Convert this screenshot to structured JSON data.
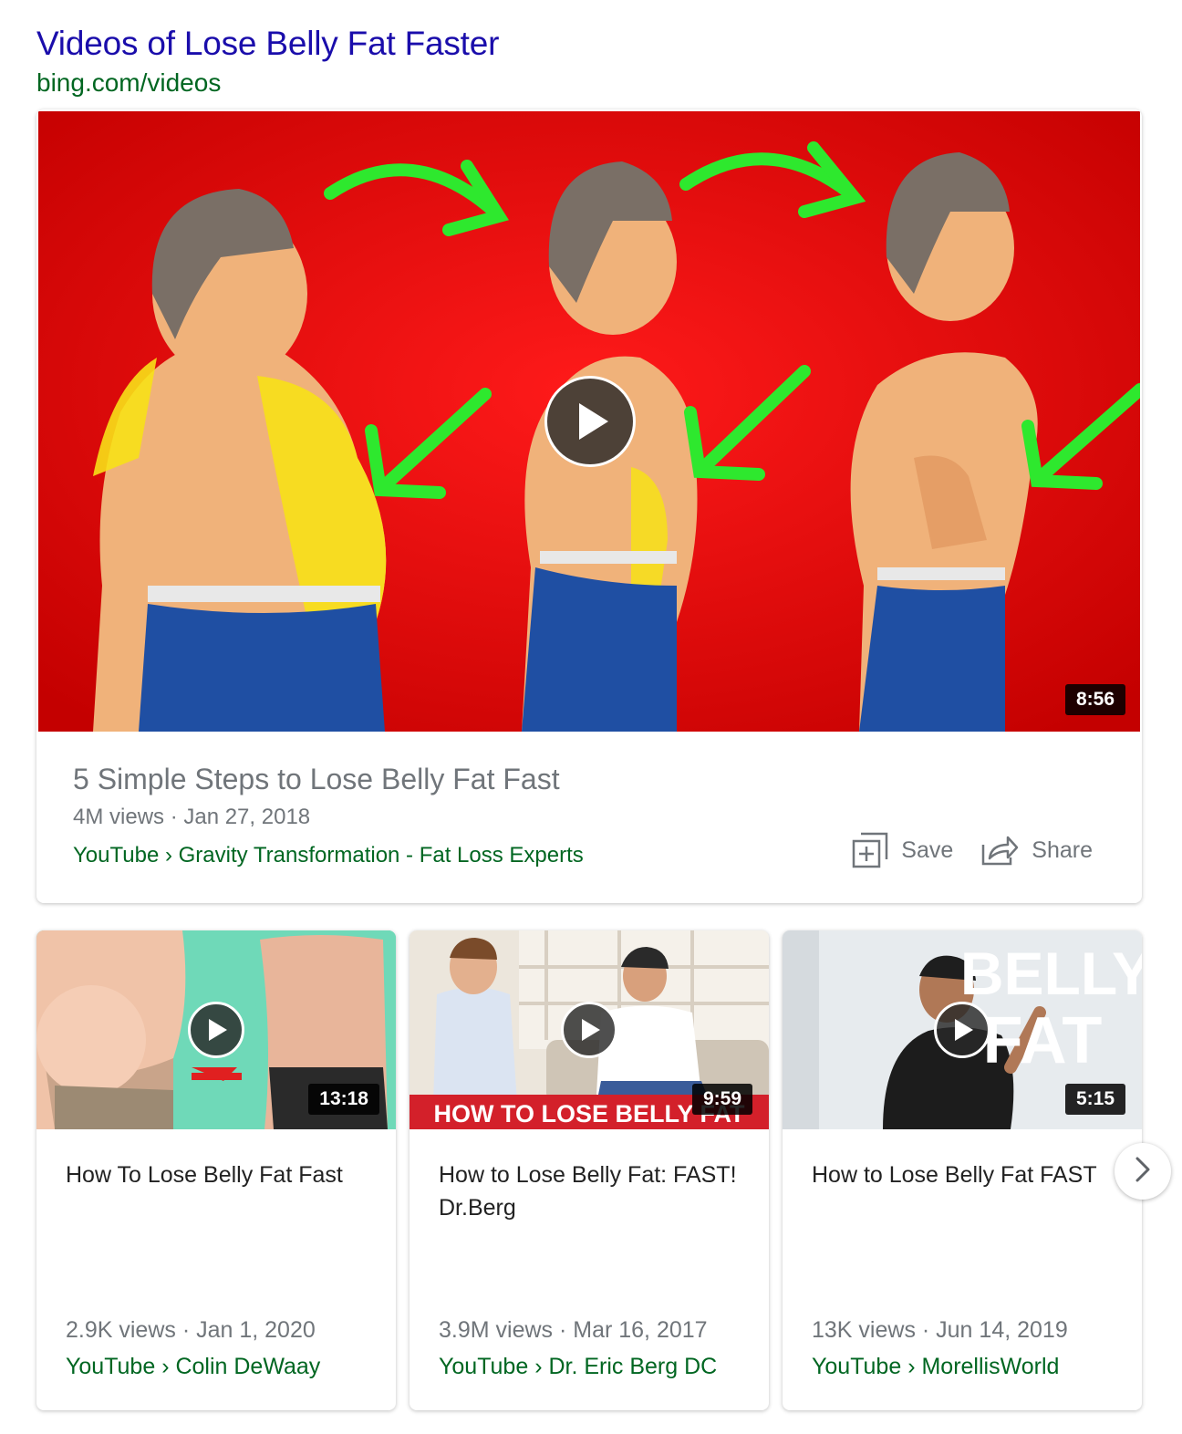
{
  "header": {
    "title": "Videos of Lose Belly Fat Faster",
    "source": "bing.com/videos"
  },
  "featured": {
    "duration": "8:56",
    "title": "5 Simple Steps to Lose Belly Fat Fast",
    "meta": "4M views · Jan 27, 2018",
    "source": "YouTube › Gravity Transformation - Fat Loss Experts",
    "save_label": "Save",
    "share_label": "Share",
    "save_icon": "add-to-list-icon",
    "share_icon": "share-arrow-icon"
  },
  "videos": [
    {
      "title": "How To Lose Belly Fat Fast",
      "duration": "13:18",
      "meta": "2.9K views · Jan 1, 2020",
      "source": "YouTube › Colin DeWaay"
    },
    {
      "title": "How to Lose Belly Fat: FAST! Dr.Berg",
      "duration": "9:59",
      "meta": "3.9M views · Mar 16, 2017",
      "source": "YouTube › Dr. Eric Berg DC",
      "thumb_banner": "HOW TO LOSE BELLY FAT"
    },
    {
      "title": "How to Lose Belly Fat FAST",
      "duration": "5:15",
      "meta": "13K views · Jun 14, 2019",
      "source": "YouTube › MorellisWorld",
      "thumb_text_1": "BELLY",
      "thumb_text_2": "FAT"
    }
  ],
  "colors": {
    "title_link": "#1a0dab",
    "source_green": "#006621",
    "meta_gray": "#70757a"
  },
  "next_icon": "chevron-right-icon"
}
